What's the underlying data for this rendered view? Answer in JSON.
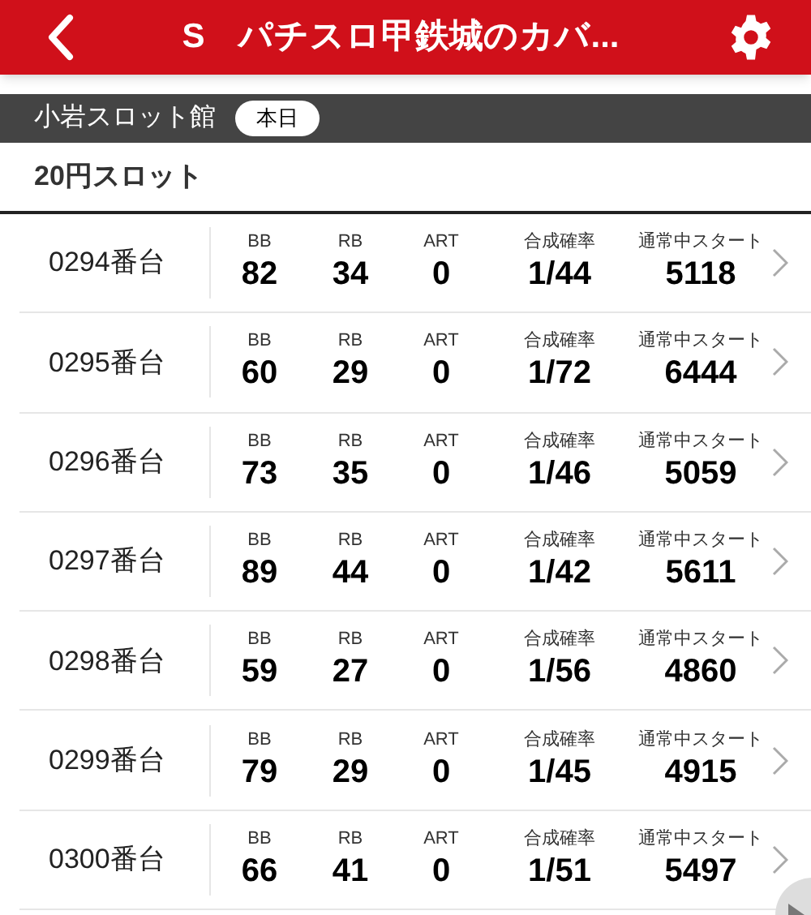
{
  "header": {
    "title": "S　パチスロ甲鉄城のカバ..."
  },
  "store_bar": {
    "store": "小岩スロット館",
    "day_chip": "本日"
  },
  "section": {
    "title": "20円スロット"
  },
  "machines": [
    {
      "name": "0294番台",
      "stats": [
        {
          "label": "BB",
          "value": "82"
        },
        {
          "label": "RB",
          "value": "34"
        },
        {
          "label": "ART",
          "value": "0"
        },
        {
          "label": "合成確率",
          "value": "1/44"
        },
        {
          "label": "通常中スタート",
          "value": "5118"
        }
      ]
    },
    {
      "name": "0295番台",
      "stats": [
        {
          "label": "BB",
          "value": "60"
        },
        {
          "label": "RB",
          "value": "29"
        },
        {
          "label": "ART",
          "value": "0"
        },
        {
          "label": "合成確率",
          "value": "1/72"
        },
        {
          "label": "通常中スタート",
          "value": "6444"
        }
      ]
    },
    {
      "name": "0296番台",
      "stats": [
        {
          "label": "BB",
          "value": "73"
        },
        {
          "label": "RB",
          "value": "35"
        },
        {
          "label": "ART",
          "value": "0"
        },
        {
          "label": "合成確率",
          "value": "1/46"
        },
        {
          "label": "通常中スタート",
          "value": "5059"
        }
      ]
    },
    {
      "name": "0297番台",
      "stats": [
        {
          "label": "BB",
          "value": "89"
        },
        {
          "label": "RB",
          "value": "44"
        },
        {
          "label": "ART",
          "value": "0"
        },
        {
          "label": "合成確率",
          "value": "1/42"
        },
        {
          "label": "通常中スタート",
          "value": "5611"
        }
      ]
    },
    {
      "name": "0298番台",
      "stats": [
        {
          "label": "BB",
          "value": "59"
        },
        {
          "label": "RB",
          "value": "27"
        },
        {
          "label": "ART",
          "value": "0"
        },
        {
          "label": "合成確率",
          "value": "1/56"
        },
        {
          "label": "通常中スタート",
          "value": "4860"
        }
      ]
    },
    {
      "name": "0299番台",
      "stats": [
        {
          "label": "BB",
          "value": "79"
        },
        {
          "label": "RB",
          "value": "29"
        },
        {
          "label": "ART",
          "value": "0"
        },
        {
          "label": "合成確率",
          "value": "1/45"
        },
        {
          "label": "通常中スタート",
          "value": "4915"
        }
      ]
    },
    {
      "name": "0300番台",
      "stats": [
        {
          "label": "BB",
          "value": "66"
        },
        {
          "label": "RB",
          "value": "41"
        },
        {
          "label": "ART",
          "value": "0"
        },
        {
          "label": "合成確率",
          "value": "1/51"
        },
        {
          "label": "通常中スタート",
          "value": "5497"
        }
      ]
    }
  ]
}
